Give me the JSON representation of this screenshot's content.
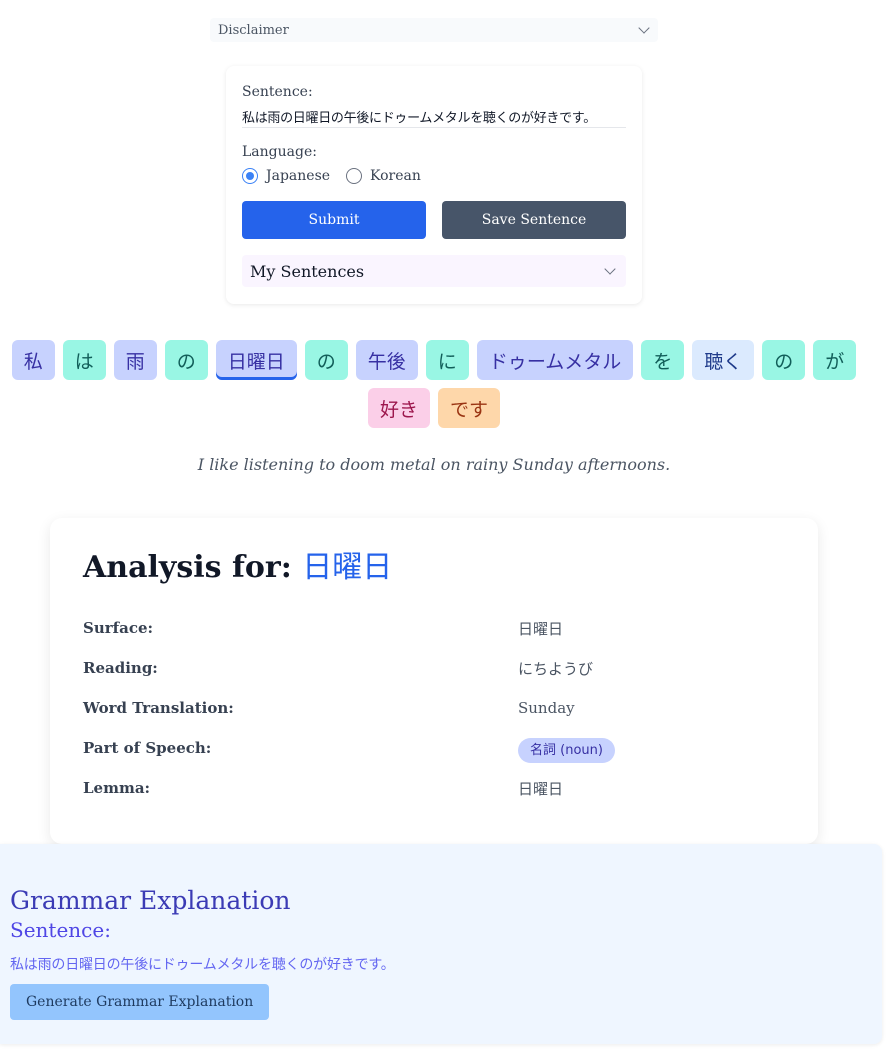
{
  "disclaimer": {
    "label": "Disclaimer"
  },
  "form": {
    "sentence_label": "Sentence:",
    "sentence_value": "私は雨の日曜日の午後にドゥームメタルを聴くのが好きです。",
    "language_label": "Language:",
    "languages": [
      {
        "label": "Japanese",
        "checked": true
      },
      {
        "label": "Korean",
        "checked": false
      }
    ],
    "submit_label": "Submit",
    "save_label": "Save Sentence",
    "my_sentences_label": "My Sentences"
  },
  "tokens": [
    {
      "text": "私",
      "pos": "noun"
    },
    {
      "text": "は",
      "pos": "particle"
    },
    {
      "text": "雨",
      "pos": "noun"
    },
    {
      "text": "の",
      "pos": "particle"
    },
    {
      "text": "日曜日",
      "pos": "noun",
      "selected": true
    },
    {
      "text": "の",
      "pos": "particle"
    },
    {
      "text": "午後",
      "pos": "noun"
    },
    {
      "text": "に",
      "pos": "particle"
    },
    {
      "text": "ドゥームメタル",
      "pos": "noun"
    },
    {
      "text": "を",
      "pos": "particle"
    },
    {
      "text": "聴く",
      "pos": "verb"
    },
    {
      "text": "の",
      "pos": "particle"
    },
    {
      "text": "が",
      "pos": "particle"
    },
    {
      "text": "好き",
      "pos": "adj"
    },
    {
      "text": "です",
      "pos": "aux"
    }
  ],
  "translation": "I like listening to doom metal on rainy Sunday afternoons.",
  "analysis": {
    "title_prefix": "Analysis for:",
    "word": "日曜日",
    "surface_label": "Surface:",
    "surface": "日曜日",
    "reading_label": "Reading:",
    "reading": "にちようび",
    "translation_label": "Word Translation:",
    "word_translation": "Sunday",
    "pos_label": "Part of Speech:",
    "pos": "名詞 (noun)",
    "lemma_label": "Lemma:",
    "lemma": "日曜日"
  },
  "grammar": {
    "title": "Grammar Explanation",
    "subtitle": "Sentence:",
    "sentence": "私は雨の日曜日の午後にドゥームメタルを聴くのが好きです。",
    "button_label": "Generate Grammar Explanation"
  },
  "colors": {
    "primary": "#2563eb",
    "secondary": "#475569",
    "noun": "#c7d2fe",
    "particle": "#99f6e4",
    "verb": "#dbeafe",
    "adjective": "#fbcfe8",
    "auxiliary": "#fed7aa"
  }
}
